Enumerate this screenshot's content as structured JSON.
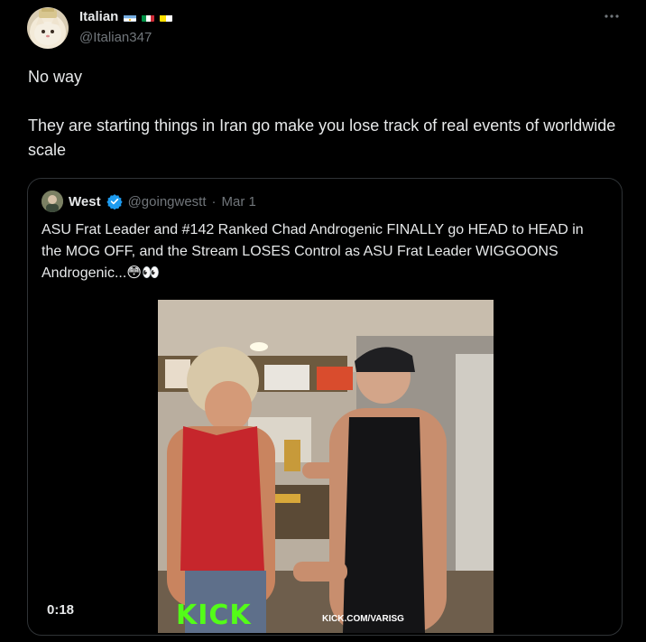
{
  "author": {
    "display_name": "Italian",
    "handle": "@Italian347",
    "badges": [
      "argentina-flag-icon",
      "italy-flag-icon",
      "vatican-flag-icon"
    ]
  },
  "more_icon": "more-options-icon",
  "tweet": {
    "paragraphs": [
      "No way",
      "They are starting things in Iran go make you lose track of real events of worldwide scale"
    ]
  },
  "quoted": {
    "display_name": "West",
    "verified": true,
    "handle": "@goingwestt",
    "separator": "·",
    "date": "Mar 1",
    "text": "ASU Frat Leader and #142 Ranked Chad Androgenic FINALLY go HEAD to HEAD in the MOG OFF, and the Stream LOSES Control as ASU Frat Leader WIGGOONS Androgenic...😳👀",
    "media": {
      "duration": "0:18",
      "watermark_logo": "KICK",
      "watermark_url": "KICK.COM/VARISG"
    }
  },
  "colors": {
    "background": "#000000",
    "text": "#e7e9ea",
    "muted": "#71767b",
    "border": "#2f3336",
    "verified": "#1d9bf0",
    "kick_green": "#53fc18"
  }
}
